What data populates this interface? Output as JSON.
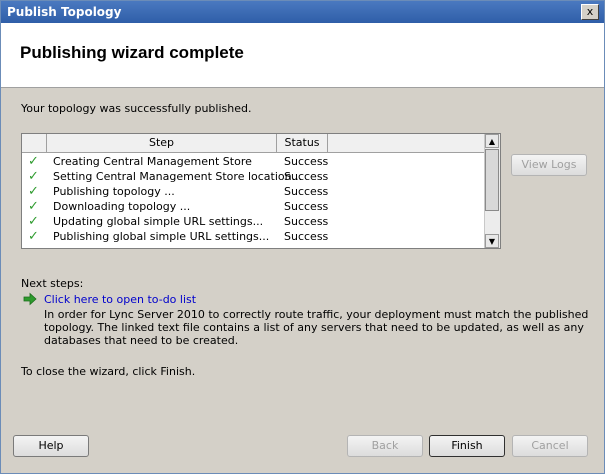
{
  "window": {
    "title": "Publish Topology",
    "close_glyph": "x"
  },
  "header": {
    "heading": "Publishing wizard complete"
  },
  "status_message": "Your topology was successfully published.",
  "list": {
    "columns": {
      "step": "Step",
      "status": "Status"
    },
    "rows": [
      {
        "step": "Creating Central Management Store",
        "status": "Success"
      },
      {
        "step": "Setting Central Management Store location...",
        "status": "Success"
      },
      {
        "step": "Publishing topology ...",
        "status": "Success"
      },
      {
        "step": "Downloading topology ...",
        "status": "Success"
      },
      {
        "step": "Updating global simple URL settings...",
        "status": "Success"
      },
      {
        "step": "Publishing global simple URL settings...",
        "status": "Success"
      }
    ],
    "check_glyph": "✓",
    "scroll_up_glyph": "▲",
    "scroll_down_glyph": "▼"
  },
  "buttons": {
    "view_logs": "View Logs",
    "help": "Help",
    "back": "Back",
    "finish": "Finish",
    "cancel": "Cancel"
  },
  "next_steps": {
    "label": "Next steps:",
    "link": "Click here to open to-do list",
    "description": "In order for Lync Server 2010 to correctly route traffic, your deployment must match the published topology. The linked text file contains a list of any servers that need to be updated, as well as any databases that need to be created."
  },
  "close_message": "To close the wizard, click Finish.",
  "colors": {
    "title_bar": "#2f5ea8",
    "check": "#2e9b2e",
    "link": "#0000cc",
    "arrow": "#2e9b2e"
  }
}
